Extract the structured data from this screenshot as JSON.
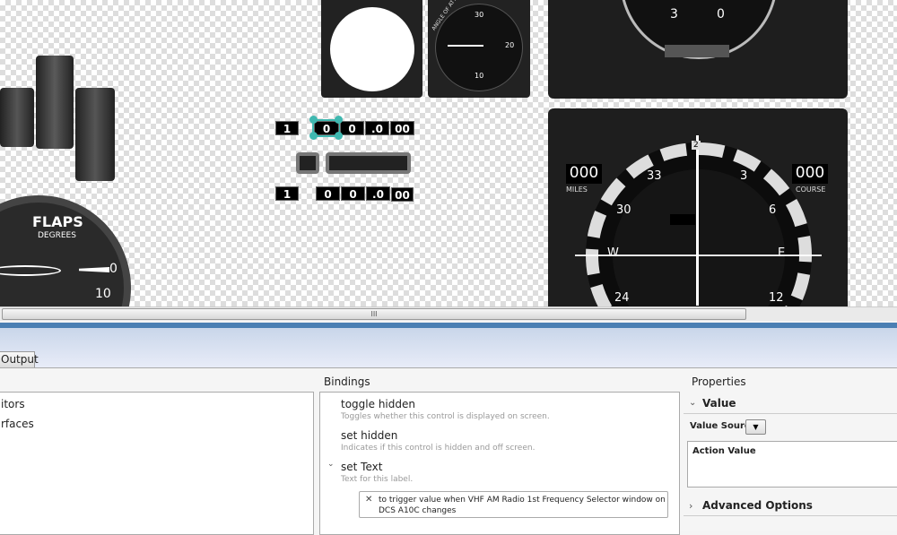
{
  "canvas": {
    "flaps": {
      "title": "FLAPS",
      "subtitle": "DEGREES",
      "marks": [
        "0",
        "10"
      ]
    },
    "aoa": {
      "label": "ANGLE OF ATTACK",
      "marks": [
        "30",
        "20",
        "10"
      ]
    },
    "adi": {
      "marks": [
        "3",
        "0"
      ]
    },
    "hsi": {
      "miles_value": "000",
      "miles_label": "MILES",
      "course_value": "000",
      "course_label": "COURSE",
      "marks": [
        "33",
        "30",
        "W",
        "3",
        "6",
        "E",
        "24",
        "12"
      ],
      "bug": "2"
    },
    "radio_top": [
      "1",
      "0",
      "0",
      ".0",
      "00"
    ],
    "radio_bottom": [
      "1",
      "0",
      "0",
      ".0",
      "00"
    ]
  },
  "scrollbar": {
    "grip": "III"
  },
  "tabs": [
    {
      "label": "Output"
    }
  ],
  "left_tree": {
    "items": [
      "itors",
      "rfaces"
    ]
  },
  "bindings": {
    "header": "Bindings",
    "items": [
      {
        "name": "toggle hidden",
        "desc": "Toggles whether this control is displayed on screen."
      },
      {
        "name": "set hidden",
        "desc": "Indicates if this control is hidden and off screen."
      },
      {
        "name": "set Text",
        "desc": "Text for this label."
      }
    ],
    "binding": "to trigger value when VHF AM Radio 1st Frequency Selector window on DCS A10C changes"
  },
  "properties": {
    "header": "Properties",
    "section": "Value",
    "value_source_label": "Value Source",
    "action_value_label": "Action Value",
    "advanced": "Advanced Options"
  },
  "colors": {
    "accent": "#4a7fb3",
    "selection": "#3fb8b0"
  }
}
